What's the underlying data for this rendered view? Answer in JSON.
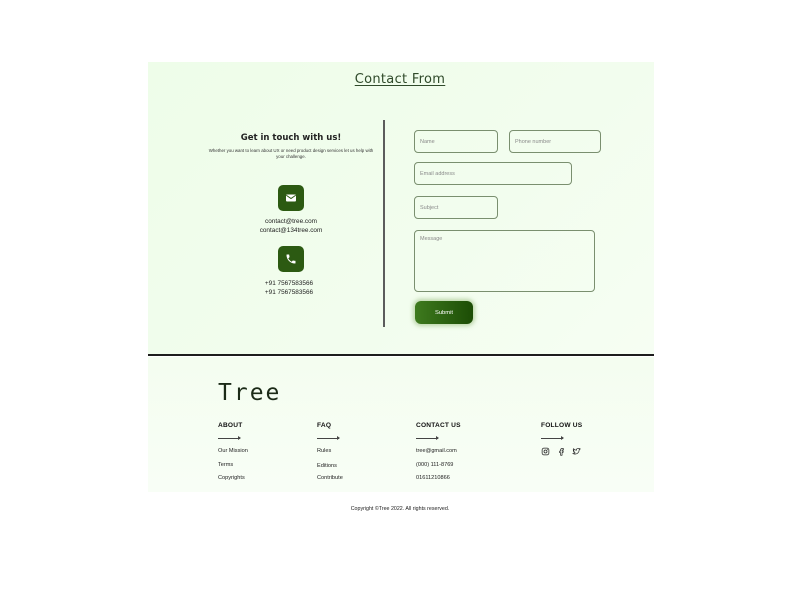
{
  "contact": {
    "title": "Contact From",
    "heading": "Get in touch with us!",
    "subtext": "Whether you want to learn about UX or need product design services let us help with your challenge.",
    "email_icon": "mail-icon",
    "emails": [
      "contact@tree.com",
      "contact@134tree.com"
    ],
    "phone_icon": "phone-icon",
    "phones": [
      "+91 7567583566",
      "+91 7567583566"
    ]
  },
  "form": {
    "name_placeholder": "Name",
    "phone_placeholder": "Phone number",
    "email_placeholder": "Email address",
    "subject_placeholder": "Subject",
    "message_placeholder": "Message",
    "submit_label": "Submit"
  },
  "footer": {
    "brand": "Tree",
    "about": {
      "title": "ABOUT",
      "links": [
        "Our Mission",
        "Terms",
        "Copyrights"
      ]
    },
    "faq": {
      "title": "FAQ",
      "links": [
        "Rules",
        "Editions",
        "Contribute"
      ]
    },
    "contact": {
      "title": "CONTACT US",
      "items": [
        "tree@gmail.com",
        "(000) 111-8769",
        "01611210866"
      ]
    },
    "follow": {
      "title": "FOLLOW US",
      "icons": [
        "instagram-icon",
        "facebook-icon",
        "twitter-icon"
      ]
    },
    "copyright": "Copyright ©Tree 2022. All rights reserved."
  },
  "colors": {
    "accent": "#2c5a12",
    "section_bg": "#f0fdec",
    "border": "#7a8f6f"
  }
}
